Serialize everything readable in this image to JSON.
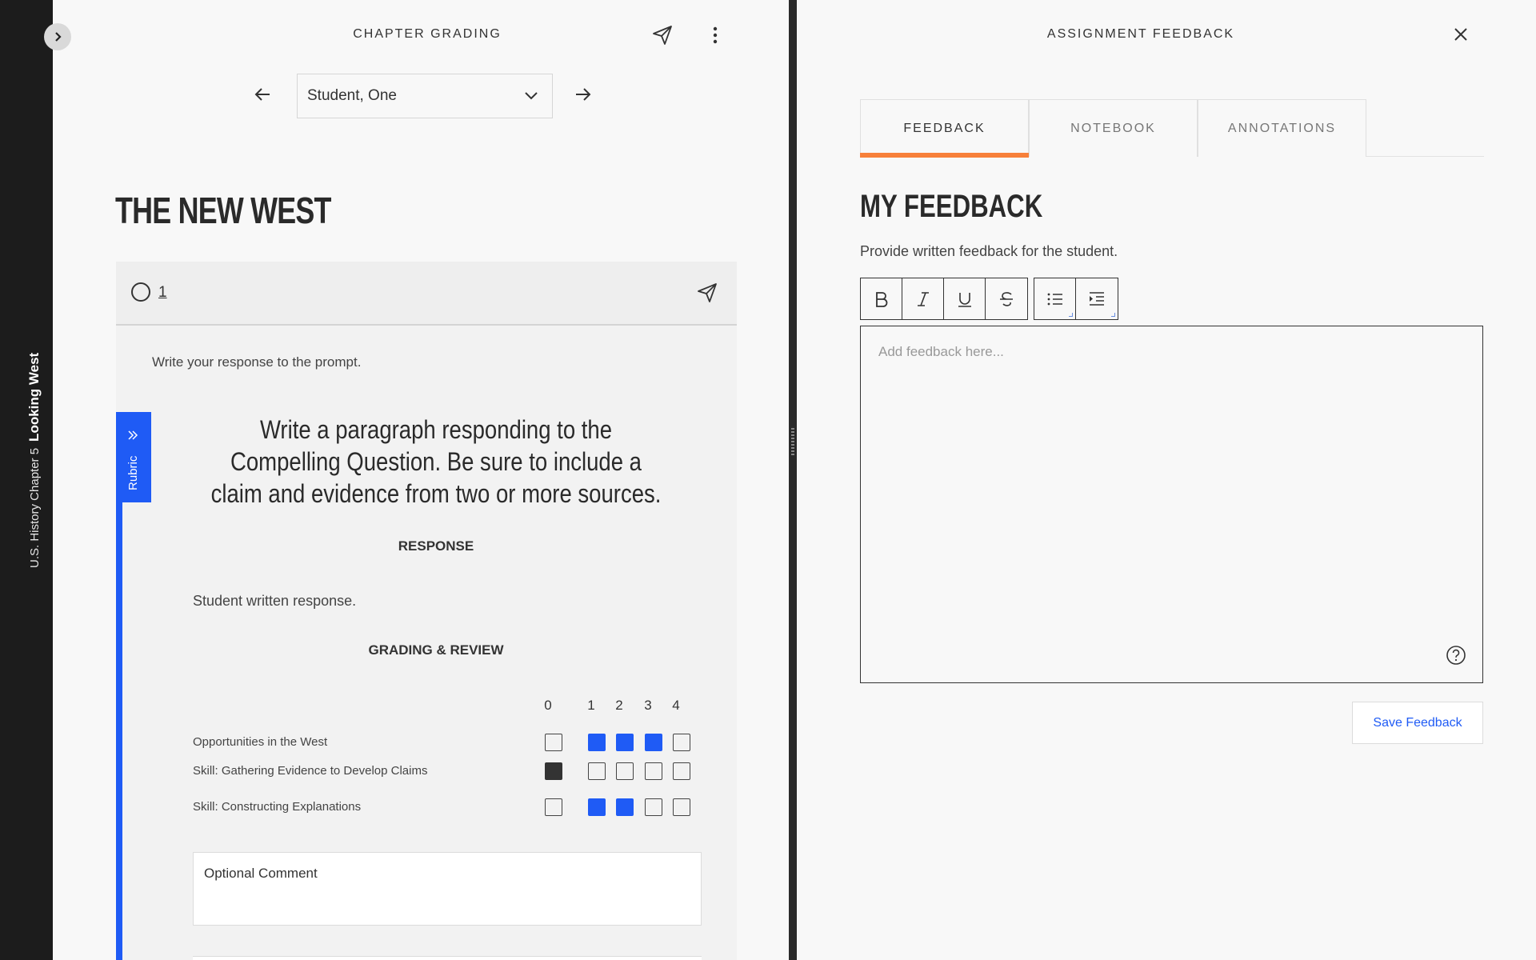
{
  "rail": {
    "course": "U.S. History Chapter 5",
    "title": "Looking West"
  },
  "left_pane": {
    "header_title": "CHAPTER GRADING",
    "student_selected": "Student, One",
    "page_title": "THE NEW WEST",
    "question_number": "1",
    "prompt_instruction": "Write your response to the prompt.",
    "rubric_tab_label": "Rubric",
    "question_text": "Write a paragraph responding to the Compelling Question. Be sure to include a claim and evidence from two or more sources.",
    "response_label": "RESPONSE",
    "response_text": "Student written response.",
    "grading_label": "GRADING & REVIEW",
    "score_columns": [
      "0",
      "1",
      "2",
      "3",
      "4"
    ],
    "criteria": [
      {
        "name": "Opportunities in the West",
        "selected": [
          1,
          2,
          3
        ]
      },
      {
        "name": "Skill: Gathering Evidence to Develop Claims",
        "selected": [
          0
        ]
      },
      {
        "name": "Skill: Constructing Explanations",
        "selected": [
          1,
          2
        ]
      }
    ],
    "comment_placeholder": "Optional Comment"
  },
  "right_pane": {
    "header_title": "ASSIGNMENT FEEDBACK",
    "tabs": [
      {
        "label": "FEEDBACK",
        "active": true
      },
      {
        "label": "NOTEBOOK",
        "active": false
      },
      {
        "label": "ANNOTATIONS",
        "active": false
      }
    ],
    "heading": "MY FEEDBACK",
    "subtext": "Provide written feedback for the student.",
    "editor_placeholder": "Add feedback here...",
    "save_label": "Save Feedback"
  },
  "colors": {
    "accent_blue": "#1f5bf5",
    "tab_active": "#f7803a",
    "rail": "#1c1c1c"
  },
  "icons": [
    "chevron-right-icon",
    "send-icon",
    "more-vertical-icon",
    "arrow-left-icon",
    "arrow-right-icon",
    "chevron-down-icon",
    "close-icon",
    "bold-icon",
    "italic-icon",
    "underline-icon",
    "strikethrough-icon",
    "bullet-list-icon",
    "indent-icon",
    "help-icon",
    "double-chevron-right-icon"
  ]
}
